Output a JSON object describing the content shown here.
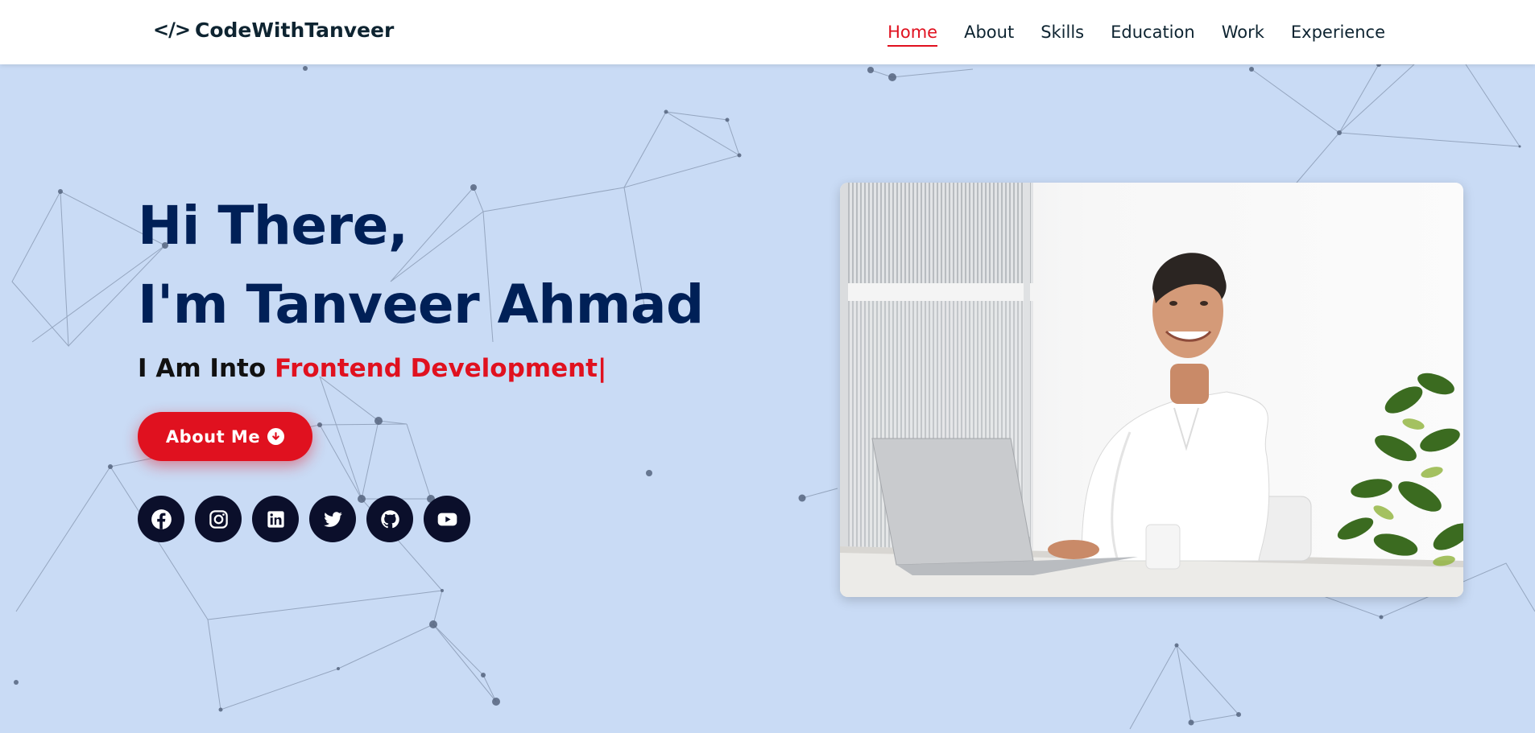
{
  "brand": {
    "logo_icon": "</>",
    "name": "CodeWithTanveer"
  },
  "nav": {
    "items": [
      {
        "label": "Home",
        "active": true
      },
      {
        "label": "About"
      },
      {
        "label": "Skills"
      },
      {
        "label": "Education"
      },
      {
        "label": "Work"
      },
      {
        "label": "Experience"
      }
    ]
  },
  "hero": {
    "greeting": "Hi There,",
    "name_line": "I'm Tanveer Ahmad",
    "into_prefix": "I Am Into",
    "typed_text": "Frontend Development",
    "cursor": "|",
    "button_label": "About Me",
    "button_icon": "arrow-down-circle-icon"
  },
  "socials": [
    {
      "name": "facebook-icon"
    },
    {
      "name": "instagram-icon"
    },
    {
      "name": "linkedin-icon"
    },
    {
      "name": "twitter-icon"
    },
    {
      "name": "github-icon"
    },
    {
      "name": "youtube-icon"
    }
  ],
  "colors": {
    "accent": "#e0111f",
    "heading": "#002057",
    "background": "#c9dbf5",
    "social_bg": "#0b0f2b"
  }
}
